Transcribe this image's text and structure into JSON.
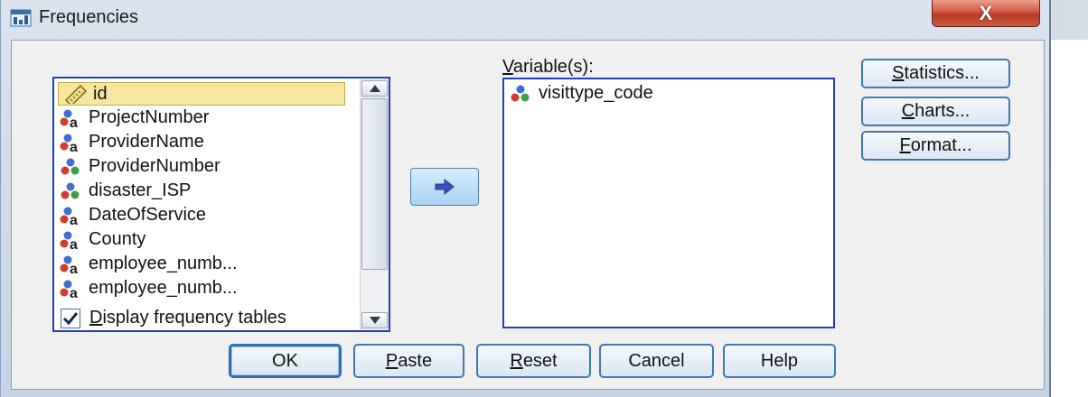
{
  "window": {
    "title": "Frequencies",
    "close_glyph": "X"
  },
  "source_list": {
    "items": [
      {
        "label": "id",
        "icon": "scale-ruler-icon",
        "selected": true
      },
      {
        "label": "ProjectNumber",
        "icon": "nominal-string-icon"
      },
      {
        "label": "ProviderName",
        "icon": "nominal-string-icon"
      },
      {
        "label": "ProviderNumber",
        "icon": "nominal-numeric-icon"
      },
      {
        "label": "disaster_ISP",
        "icon": "nominal-numeric-icon"
      },
      {
        "label": "DateOfService",
        "icon": "nominal-string-icon"
      },
      {
        "label": "County",
        "icon": "nominal-string-icon"
      },
      {
        "label": "employee_numb...",
        "icon": "nominal-string-icon"
      },
      {
        "label": "employee_numb...",
        "icon": "nominal-string-icon"
      }
    ]
  },
  "move_button": {
    "icon": "right-arrow-icon"
  },
  "target": {
    "label": "Variable(s):",
    "items": [
      {
        "label": "visittype_code",
        "icon": "nominal-numeric-icon"
      }
    ]
  },
  "side_buttons": {
    "statistics": {
      "pre": "",
      "u": "S",
      "post": "tatistics..."
    },
    "charts": {
      "pre": "",
      "u": "C",
      "post": "harts..."
    },
    "format": {
      "pre": "",
      "u": "F",
      "post": "ormat..."
    }
  },
  "checkbox": {
    "pre": "",
    "u": "D",
    "post": "isplay frequency tables",
    "checked": true
  },
  "bottom_buttons": {
    "ok": "OK",
    "paste": {
      "u": "P",
      "post": "aste"
    },
    "reset": {
      "u": "R",
      "post": "eset"
    },
    "cancel": "Cancel",
    "help": "Help"
  },
  "colors": {
    "list_border": "#1f3fbf",
    "button_border": "#3f78b8",
    "close_red": "#c9412b",
    "selection": "#f5e6a0"
  }
}
